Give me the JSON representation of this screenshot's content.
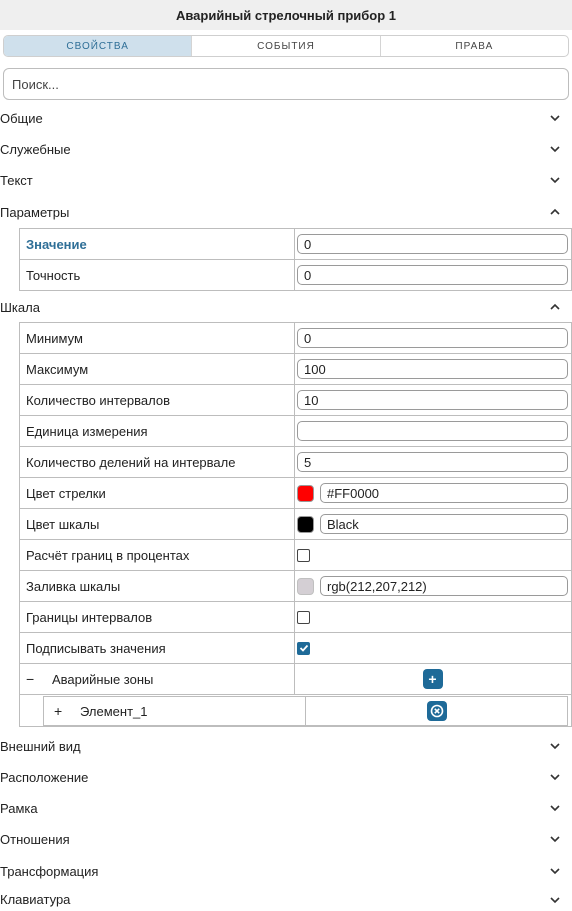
{
  "title": "Аварийный стрелочный прибор 1",
  "tabs": [
    {
      "label": "СВОЙСТВА"
    },
    {
      "label": "СОБЫТИЯ"
    },
    {
      "label": "ПРАВА"
    }
  ],
  "search": {
    "placeholder": "Поиск..."
  },
  "sections": {
    "general": "Общие",
    "service": "Служебные",
    "text": "Текст",
    "params": "Параметры",
    "scale": "Шкала",
    "appearance": "Внешний вид",
    "position": "Расположение",
    "frame": "Рамка",
    "relations": "Отношения",
    "transform": "Трансформация",
    "keyboard": "Клавиатура"
  },
  "params": {
    "value_label": "Значение",
    "value": "0",
    "precision_label": "Точность",
    "precision": "0"
  },
  "scale": {
    "min_label": "Минимум",
    "min": "0",
    "max_label": "Максимум",
    "max": "100",
    "intervals_label": "Количество интервалов",
    "intervals": "10",
    "unit_label": "Единица измерения",
    "unit": "",
    "divisions_label": "Количество делений на интервале",
    "divisions": "5",
    "needle_color_label": "Цвет стрелки",
    "needle_color": "#FF0000",
    "needle_color_swatch": "#ff0000",
    "scale_color_label": "Цвет шкалы",
    "scale_color": "Black",
    "scale_color_swatch": "#000000",
    "percent_label": "Расчёт границ в процентах",
    "percent_checked": false,
    "fill_label": "Заливка шкалы",
    "fill": "rgb(212,207,212)",
    "fill_swatch": "#d4cfd4",
    "bounds_label": "Границы интервалов",
    "bounds_checked": false,
    "sign_label": "Подписывать значения",
    "sign_checked": true,
    "zones_toggle": "−",
    "zones_label": "Аварийные зоны",
    "zones_add": "+",
    "element_toggle": "+",
    "element_label": "Элемент_1"
  },
  "colors": {
    "accent": "#1e6a98",
    "active_tab_bg": "#cfe0ec"
  }
}
